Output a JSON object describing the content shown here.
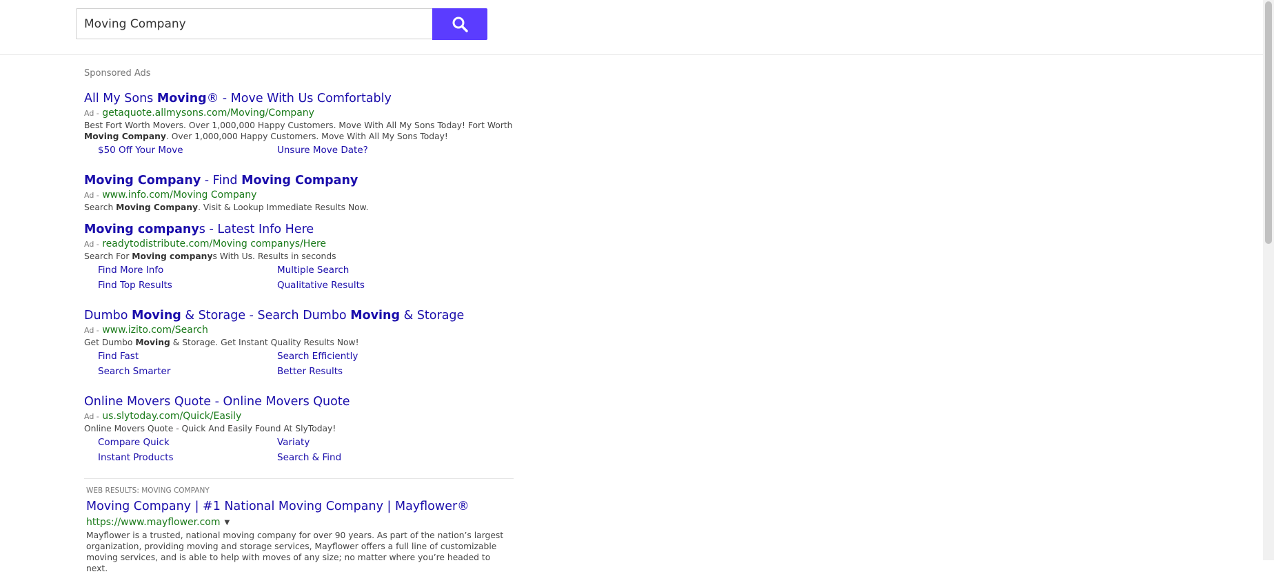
{
  "search": {
    "value": "Moving Company",
    "button_icon": "search-icon"
  },
  "sponsored_label": "Sponsored Ads",
  "ad_tag": "Ad -",
  "ads": [
    {
      "title_parts": [
        "All My Sons ",
        "Moving",
        "® - Move With Us Comfortably"
      ],
      "url": "getaquote.allmysons.com/Moving/Company",
      "desc_parts": [
        "Best Fort Worth Movers. Over 1,000,000 Happy Customers. Move With All My Sons Today! Fort Worth ",
        "Moving Company",
        ". Over 1,000,000 Happy Customers. Move With All My Sons Today!"
      ],
      "sitelinks": [
        "$50 Off Your Move",
        "Unsure Move Date?"
      ]
    },
    {
      "title_parts": [
        "",
        "Moving Company",
        " - Find ",
        "Moving Company"
      ],
      "url": "www.info.com/Moving Company",
      "desc_parts": [
        "Search ",
        "Moving Company",
        ". Visit & Lookup Immediate Results Now."
      ],
      "sitelinks": []
    },
    {
      "title_parts": [
        "",
        "Moving company",
        "s - Latest Info Here"
      ],
      "url": "readytodistribute.com/Moving companys/Here",
      "desc_parts": [
        "Search For ",
        "Moving company",
        "s With Us. Results in seconds"
      ],
      "sitelinks": [
        "Find More Info",
        "Multiple Search",
        "Find Top Results",
        "Qualitative Results"
      ]
    },
    {
      "title_parts": [
        "Dumbo ",
        "Moving",
        " & Storage - Search Dumbo ",
        "Moving",
        " & Storage"
      ],
      "url": "www.izito.com/Search",
      "desc_parts": [
        "Get Dumbo ",
        "Moving",
        " & Storage. Get Instant Quality Results Now!"
      ],
      "sitelinks": [
        "Find Fast",
        "Search Efficiently",
        "Search Smarter",
        "Better Results"
      ]
    },
    {
      "title_parts": [
        "Online Movers Quote - Online Movers Quote"
      ],
      "url": "us.slytoday.com/Quick/Easily",
      "desc_parts": [
        "Online Movers Quote - Quick And Easily Found At SlyToday!"
      ],
      "sitelinks": [
        "Compare Quick",
        "Variaty",
        "Instant Products",
        "Search & Find"
      ]
    }
  ],
  "web_results_label": "WEB RESULTS: MOVING COMPANY",
  "results": [
    {
      "title": "Moving Company | #1 National Moving Company | Mayflower®",
      "url": "https://www.mayflower.com",
      "caret_icon": "chevron-down-icon",
      "snippet": "Mayflower is a trusted, national moving company for over 90 years. As part of the nation’s largest organization, providing moving and storage services, Mayflower offers a full line of customizable moving services, and is able to help with moves of any size; no matter where you’re headed to next."
    }
  ]
}
